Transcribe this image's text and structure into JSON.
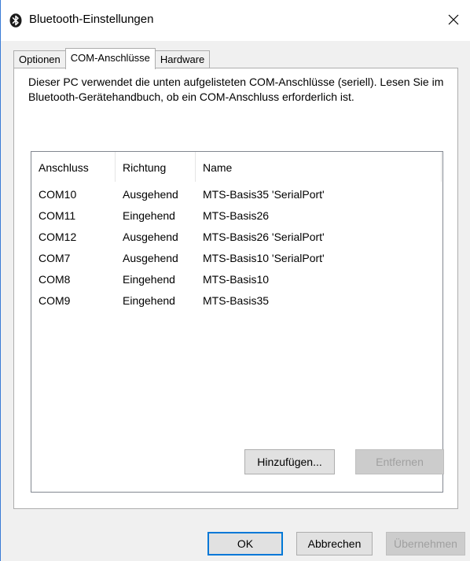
{
  "window": {
    "title": "Bluetooth-Einstellungen",
    "close_glyph": "✕",
    "accent_color": "#0078d7"
  },
  "tabs": [
    {
      "label": "Optionen",
      "active": false
    },
    {
      "label": "COM-Anschlüsse",
      "active": true
    },
    {
      "label": "Hardware",
      "active": false
    }
  ],
  "panel": {
    "description": "Dieser PC verwendet die unten aufgelisteten COM-Anschlüsse (seriell). Lesen Sie im Bluetooth-Gerätehandbuch, ob ein COM-Anschluss erforderlich ist.",
    "columns": [
      "Anschluss",
      "Richtung",
      "Name"
    ],
    "rows": [
      {
        "port": "COM10",
        "direction": "Ausgehend",
        "name": "MTS-Basis35 'SerialPort'"
      },
      {
        "port": "COM11",
        "direction": "Eingehend",
        "name": "MTS-Basis26"
      },
      {
        "port": "COM12",
        "direction": "Ausgehend",
        "name": "MTS-Basis26 'SerialPort'"
      },
      {
        "port": "COM7",
        "direction": "Ausgehend",
        "name": "MTS-Basis10 'SerialPort'"
      },
      {
        "port": "COM8",
        "direction": "Eingehend",
        "name": "MTS-Basis10"
      },
      {
        "port": "COM9",
        "direction": "Eingehend",
        "name": "MTS-Basis35"
      }
    ],
    "add_label": "Hinzufügen...",
    "remove_label": "Entfernen"
  },
  "footer": {
    "ok_label": "OK",
    "cancel_label": "Abbrechen",
    "apply_label": "Übernehmen"
  },
  "icons": {
    "title_icon": "bluetooth-icon",
    "close_icon": "close-icon"
  }
}
